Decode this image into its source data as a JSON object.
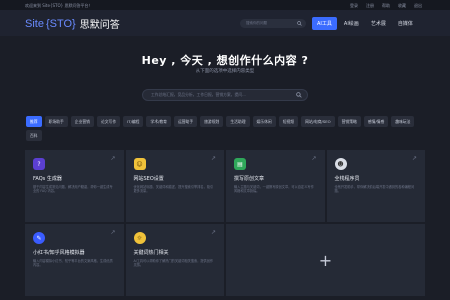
{
  "topbar": {
    "welcome": "欢迎来到 Site{STO} 思默问答平台！",
    "links": [
      "登录",
      "注册",
      "帮助",
      "收藏",
      "退出"
    ]
  },
  "header": {
    "logo_prefix": "Site",
    "logo_mid": "{STO}",
    "logo_name": "思默问答",
    "search_placeholder": "搜索你的问题",
    "nav": [
      {
        "label": "AI工具",
        "active": true
      },
      {
        "label": "AI绘画",
        "active": false
      },
      {
        "label": "艺术展",
        "active": false
      },
      {
        "label": "自媒体",
        "active": false
      }
    ]
  },
  "hero": {
    "title": "Hey , 今天 , 想创作什么内容 ?",
    "subtitle": "从下面的选项中选择内容类型",
    "search_placeholder": "工作总结汇报，竞品分析，工作日报，营销方案，提问..."
  },
  "chips": [
    {
      "label": "推荐",
      "active": true
    },
    {
      "label": "职场助手",
      "active": false
    },
    {
      "label": "企业营销",
      "active": false
    },
    {
      "label": "论文写作",
      "active": false
    },
    {
      "label": "IT/编程",
      "active": false
    },
    {
      "label": "学术/教育",
      "active": false
    },
    {
      "label": "运营助手",
      "active": false
    },
    {
      "label": "旅游规划",
      "active": false
    },
    {
      "label": "生活助理",
      "active": false
    },
    {
      "label": "娱乐休闲",
      "active": false
    },
    {
      "label": "短视频",
      "active": false
    },
    {
      "label": "网站/电商/SEO",
      "active": false
    },
    {
      "label": "营销策略",
      "active": false
    },
    {
      "label": "感情/情感",
      "active": false
    },
    {
      "label": "趣味玩法",
      "active": false
    },
    {
      "label": "百科",
      "active": false
    }
  ],
  "cards": [
    {
      "title": "FAQs 生成器",
      "desc": "基于内容生成常见问题，解决用户疑惑，帮你一键生成专业的 FAQ 内容。",
      "icon": "faq-icon",
      "icon_bg": "#5b3fd1",
      "icon_glyph": "?"
    },
    {
      "title": "网站SEO设置",
      "desc": "优化网站标题、关键词和描述，提升搜索引擎排名，吸引更多流量。",
      "icon": "seo-icon",
      "icon_bg": "#f0c23a",
      "icon_glyph": "☺"
    },
    {
      "title": "撰写原创文章",
      "desc": "输入主题与关键词，一键撰写原创文章，可以自定义写作风格和文章篇幅。",
      "icon": "article-icon",
      "icon_bg": "#2fa75a",
      "icon_glyph": "▤"
    },
    {
      "title": "全栈程序员",
      "desc": "全栈开发助手，帮你解决前后端开发中遇到的各种编程问题。",
      "icon": "programmer-icon",
      "icon_bg": "#d9dde6",
      "icon_glyph": "☻"
    },
    {
      "title": "小红书/知乎风格模拟器",
      "desc": "输入内容模拟小红书、知乎等平台的文案风格，生成优质内容。",
      "icon": "style-icon",
      "icon_bg": "#3a5cff",
      "icon_glyph": "✎"
    },
    {
      "title": "关键词热门相关",
      "desc": "AI工具可以帮助你了解热门的关键词相关搜索，提供创作灵感。",
      "icon": "keyword-icon",
      "icon_bg": "#f0c23a",
      "icon_glyph": "☼"
    }
  ],
  "add_card": {
    "label": "+"
  },
  "arrow_glyph": "↗",
  "colors": {
    "accent": "#3b6cff",
    "background": "#1b1e27",
    "card": "#252a36"
  }
}
